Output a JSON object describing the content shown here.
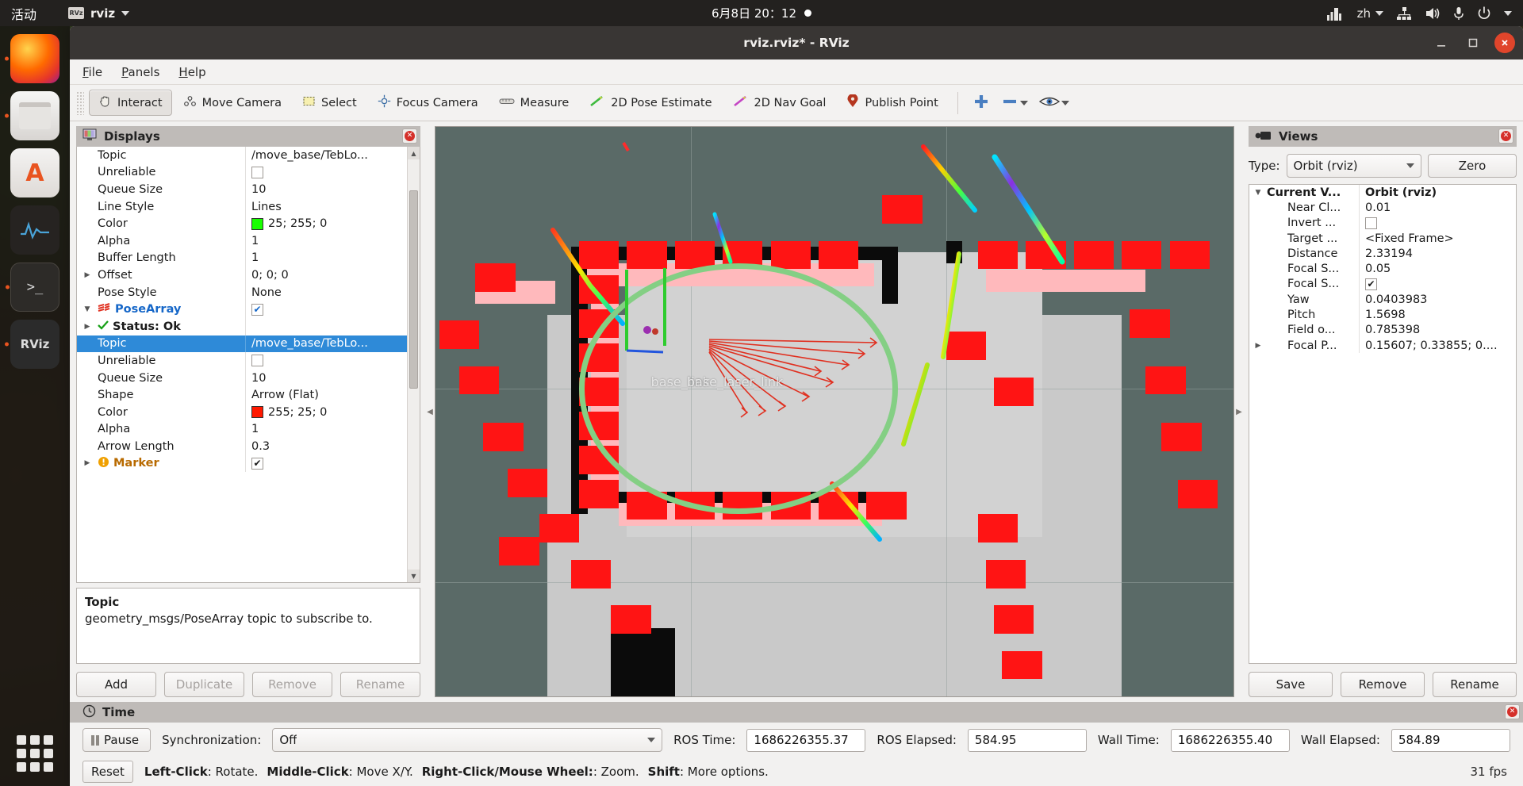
{
  "desktop": {
    "activities": "活动",
    "app_menu": "rviz",
    "clock": "6月8日 20：12",
    "tray": {
      "language": "zh",
      "icons": [
        "signal-icon",
        "language-icon",
        "network-icon",
        "volume-icon",
        "microphone-icon",
        "power-icon",
        "chevron-down-icon"
      ]
    },
    "dock": [
      {
        "name": "firefox",
        "label": "Firefox"
      },
      {
        "name": "files",
        "label": "Files"
      },
      {
        "name": "software",
        "label": "Ubuntu Software"
      },
      {
        "name": "system-monitor",
        "label": "System Monitor"
      },
      {
        "name": "terminal",
        "label": "Terminal"
      },
      {
        "name": "rviz",
        "label": "RViz"
      }
    ],
    "show_apps": "show-applications"
  },
  "window": {
    "title": "rviz.rviz* - RViz",
    "minimize": "–",
    "maximize": "❐",
    "close": "✕"
  },
  "menubar": [
    "File",
    "Panels",
    "Help"
  ],
  "toolbar": [
    {
      "label": "Interact",
      "icon": "hand-icon",
      "active": true
    },
    {
      "label": "Move Camera",
      "icon": "move-camera-icon",
      "active": false
    },
    {
      "label": "Select",
      "icon": "select-icon",
      "active": false
    },
    {
      "label": "Focus Camera",
      "icon": "focus-camera-icon",
      "active": false
    },
    {
      "label": "Measure",
      "icon": "measure-icon",
      "active": false
    },
    {
      "label": "2D Pose Estimate",
      "icon": "pose-estimate-icon",
      "active": false
    },
    {
      "label": "2D Nav Goal",
      "icon": "nav-goal-icon",
      "active": false
    },
    {
      "label": "Publish Point",
      "icon": "publish-point-icon",
      "active": false
    }
  ],
  "toolbar_extra": [
    "plus-icon",
    "minus-icon",
    "eye-icon"
  ],
  "displays": {
    "panel_title": "Displays",
    "rows": [
      {
        "indent": 1,
        "arrow": "",
        "name": "Topic",
        "value": "/move_base/TebLo...",
        "type": "text",
        "selected": false
      },
      {
        "indent": 1,
        "arrow": "",
        "name": "Unreliable",
        "value": "",
        "type": "checkbox",
        "checked": false,
        "selected": false
      },
      {
        "indent": 1,
        "arrow": "",
        "name": "Queue Size",
        "value": "10",
        "type": "text",
        "selected": false
      },
      {
        "indent": 1,
        "arrow": "",
        "name": "Line Style",
        "value": "Lines",
        "type": "text",
        "selected": false
      },
      {
        "indent": 1,
        "arrow": "",
        "name": "Color",
        "value": "25; 255; 0",
        "type": "color",
        "color": "#19ff00",
        "selected": false
      },
      {
        "indent": 1,
        "arrow": "",
        "name": "Alpha",
        "value": "1",
        "type": "text",
        "selected": false
      },
      {
        "indent": 1,
        "arrow": "",
        "name": "Buffer Length",
        "value": "1",
        "type": "text",
        "selected": false
      },
      {
        "indent": 1,
        "arrow": "▶",
        "name": "Offset",
        "value": "0; 0; 0",
        "type": "text",
        "selected": false
      },
      {
        "indent": 1,
        "arrow": "",
        "name": "Pose Style",
        "value": "None",
        "type": "text",
        "selected": false
      },
      {
        "indent": 0,
        "arrow": "▼",
        "name": "PoseArray",
        "value": "",
        "type": "checkbox",
        "checked": true,
        "selected": false,
        "style": "blue-bold",
        "icon": "posearray-icon"
      },
      {
        "indent": 1,
        "arrow": "▶",
        "name": "Status: Ok",
        "value": "",
        "type": "status",
        "selected": false
      },
      {
        "indent": 1,
        "arrow": "",
        "name": "Topic",
        "value": "/move_base/TebLo...",
        "type": "text",
        "selected": true
      },
      {
        "indent": 1,
        "arrow": "",
        "name": "Unreliable",
        "value": "",
        "type": "checkbox",
        "checked": false,
        "selected": false
      },
      {
        "indent": 1,
        "arrow": "",
        "name": "Queue Size",
        "value": "10",
        "type": "text",
        "selected": false
      },
      {
        "indent": 1,
        "arrow": "",
        "name": "Shape",
        "value": "Arrow (Flat)",
        "type": "text",
        "selected": false
      },
      {
        "indent": 1,
        "arrow": "",
        "name": "Color",
        "value": "255; 25; 0",
        "type": "color",
        "color": "#ff1900",
        "selected": false
      },
      {
        "indent": 1,
        "arrow": "",
        "name": "Alpha",
        "value": "1",
        "type": "text",
        "selected": false
      },
      {
        "indent": 1,
        "arrow": "",
        "name": "Arrow Length",
        "value": "0.3",
        "type": "text",
        "selected": false
      },
      {
        "indent": 0,
        "arrow": "▶",
        "name": "Marker",
        "value": "",
        "type": "checkbox",
        "checked": true,
        "selected": false,
        "style": "orange-bold",
        "icon": "marker-icon"
      }
    ],
    "description": {
      "title": "Topic",
      "text": "geometry_msgs/PoseArray topic to subscribe to."
    },
    "buttons": [
      {
        "label": "Add",
        "enabled": true
      },
      {
        "label": "Duplicate",
        "enabled": false
      },
      {
        "label": "Remove",
        "enabled": false
      },
      {
        "label": "Rename",
        "enabled": false
      }
    ]
  },
  "views": {
    "panel_title": "Views",
    "type_label": "Type:",
    "type_value": "Orbit (rviz)",
    "zero_button": "Zero",
    "rows": [
      {
        "indent": 0,
        "arrow": "▼",
        "name": "Current V...",
        "value": "Orbit (rviz)",
        "type": "text",
        "header": true
      },
      {
        "indent": 1,
        "arrow": "",
        "name": "Near Cl...",
        "value": "0.01",
        "type": "text"
      },
      {
        "indent": 1,
        "arrow": "",
        "name": "Invert ...",
        "value": "",
        "type": "checkbox",
        "checked": false
      },
      {
        "indent": 1,
        "arrow": "",
        "name": "Target ...",
        "value": "<Fixed Frame>",
        "type": "text"
      },
      {
        "indent": 1,
        "arrow": "",
        "name": "Distance",
        "value": "2.33194",
        "type": "text"
      },
      {
        "indent": 1,
        "arrow": "",
        "name": "Focal S...",
        "value": "0.05",
        "type": "text"
      },
      {
        "indent": 1,
        "arrow": "",
        "name": "Focal S...",
        "value": "",
        "type": "checkbox",
        "checked": true
      },
      {
        "indent": 1,
        "arrow": "",
        "name": "Yaw",
        "value": "0.0403983",
        "type": "text"
      },
      {
        "indent": 1,
        "arrow": "",
        "name": "Pitch",
        "value": "1.5698",
        "type": "text"
      },
      {
        "indent": 1,
        "arrow": "",
        "name": "Field o...",
        "value": "0.785398",
        "type": "text"
      },
      {
        "indent": 1,
        "arrow": "▶",
        "name": "Focal P...",
        "value": "0.15607; 0.33855; 0....",
        "type": "text"
      }
    ],
    "buttons": [
      {
        "label": "Save"
      },
      {
        "label": "Remove"
      },
      {
        "label": "Rename"
      }
    ]
  },
  "viewport": {
    "labels": [
      "base_link",
      "base_laser_link"
    ]
  },
  "time": {
    "panel_title": "Time",
    "pause_label": "Pause",
    "sync_label": "Synchronization:",
    "sync_value": "Off",
    "ros_time_label": "ROS Time:",
    "ros_time_value": "1686226355.37",
    "ros_elapsed_label": "ROS Elapsed:",
    "ros_elapsed_value": "584.95",
    "wall_time_label": "Wall Time:",
    "wall_time_value": "1686226355.40",
    "wall_elapsed_label": "Wall Elapsed:",
    "wall_elapsed_value": "584.89",
    "reset_label": "Reset",
    "hints": [
      {
        "key": "Left-Click",
        "text": ": Rotate."
      },
      {
        "key": "Middle-Click",
        "text": ": Move X/Y."
      },
      {
        "key": "Right-Click/Mouse Wheel:",
        "text": ": Zoom."
      },
      {
        "key": "Shift",
        "text": ": More options."
      }
    ],
    "fps": "31 fps"
  },
  "colors": {
    "accent": "#2e8ad8",
    "panel_header": "#bfbbb8",
    "green_path": "#84cf84",
    "obstacle_red": "#ff1414",
    "ground": "#c9c9c9",
    "sky": "#5a6a67"
  }
}
